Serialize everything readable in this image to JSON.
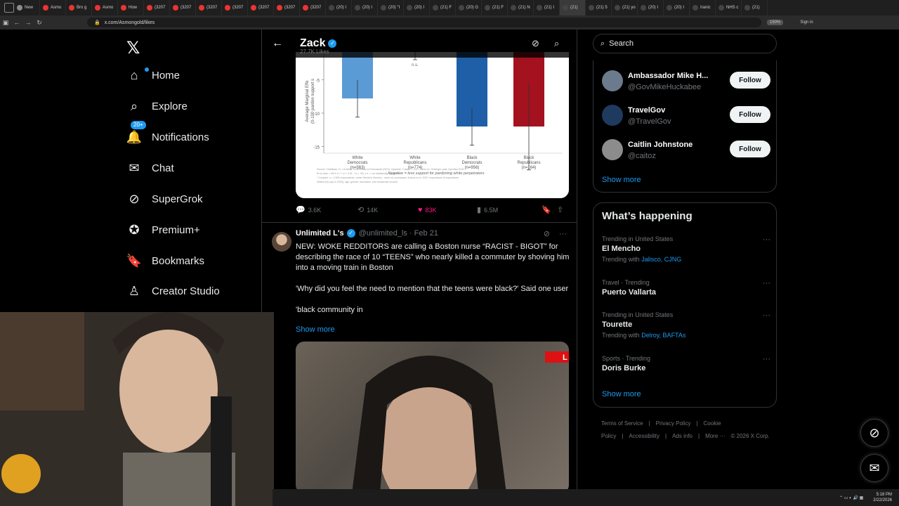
{
  "browser": {
    "tabs": [
      {
        "label": "New",
        "color": "#8c8c8c"
      },
      {
        "label": "Asmo",
        "color": "#e33"
      },
      {
        "label": "Bro g",
        "color": "#e33"
      },
      {
        "label": "Asmo",
        "color": "#e33"
      },
      {
        "label": "How",
        "color": "#e33"
      },
      {
        "label": "(3207",
        "color": "#e33"
      },
      {
        "label": "(3207",
        "color": "#e33"
      },
      {
        "label": "(3207",
        "color": "#e33"
      },
      {
        "label": "(3207",
        "color": "#e33"
      },
      {
        "label": "(3207",
        "color": "#e33"
      },
      {
        "label": "(3207",
        "color": "#e33"
      },
      {
        "label": "(3207",
        "color": "#e33"
      },
      {
        "label": "(20) I",
        "color": "#444"
      },
      {
        "label": "(20) I",
        "color": "#444"
      },
      {
        "label": "(20) \"I",
        "color": "#444"
      },
      {
        "label": "(20) I",
        "color": "#444"
      },
      {
        "label": "(21) F",
        "color": "#444"
      },
      {
        "label": "(20) G",
        "color": "#444"
      },
      {
        "label": "(21) F",
        "color": "#444"
      },
      {
        "label": "(21) N",
        "color": "#444"
      },
      {
        "label": "(21) I",
        "color": "#444"
      },
      {
        "label": "(21)",
        "color": "#444",
        "active": true
      },
      {
        "label": "(21) 5",
        "color": "#444"
      },
      {
        "label": "(21) yo",
        "color": "#444"
      },
      {
        "label": "(20) I",
        "color": "#444"
      },
      {
        "label": "(20) I",
        "color": "#444"
      },
      {
        "label": "Iranic",
        "color": "#444"
      },
      {
        "label": "NHS c",
        "color": "#444"
      },
      {
        "label": "(21)",
        "color": "#444"
      }
    ],
    "url": "x.com/Asmongold/likes",
    "zoom": "150%",
    "signin": "Sign in"
  },
  "nav": {
    "logo": "𝕏",
    "items": [
      {
        "label": "Home",
        "icon": "⌂"
      },
      {
        "label": "Explore",
        "icon": "⌕"
      },
      {
        "label": "Notifications",
        "icon": "🔔",
        "badge": "20+"
      },
      {
        "label": "Chat",
        "icon": "✉"
      },
      {
        "label": "SuperGrok",
        "icon": "⊘"
      },
      {
        "label": "Premium+",
        "icon": "✪"
      },
      {
        "label": "Bookmarks",
        "icon": "🔖"
      },
      {
        "label": "Creator Studio",
        "icon": "♙"
      }
    ]
  },
  "header": {
    "back": "←",
    "title": "Zack",
    "subtitle": "27.7K Likes"
  },
  "chart_data": {
    "type": "bar",
    "categories": [
      "White\nDemocrats\n(n=563)",
      "White\nRepublicans\n(n=774)",
      "Black\nDemocrats\n(n=956)",
      "Black\nRepublicans\n(n=164)"
    ],
    "values": [
      -7.8,
      -0.8,
      -12,
      -12
    ],
    "errors": [
      2.8,
      1.2,
      2.8,
      6.5
    ],
    "bar_colors": [
      "#5b9bd5",
      "#cccccc",
      "#1f5fa8",
      "#a3121e"
    ],
    "ylabel": "Average Marginal Effe",
    "ylabel2": "(0-100 pardon support s",
    "yticks": [
      -5,
      -10,
      -15
    ],
    "ylim": [
      -20,
      0
    ],
    "note": "Negative = less support for pardoning white perpetrators",
    "na_label": "n.s.",
    "source_lines": [
      "Source: Chistilsan, H., Lerdhau, Chommisau & Ehrouawsll (2021). Nparedz: Tulas d T u in t. Nrich on: Tinbinger paar, hiprvllka 2022.",
      "Error bars = 95% CI; ** p < 0.01, * p < .05; n.s. = not statistically significant.",
      "* Conjoint: n = 2,500 respondents, under Nevick's Dimulec - each ca. purchased. Antone et al. 2020. Importance of expenditure",
      "   related (for pay in 2020), age, gender, education, and household income."
    ]
  },
  "tweet1": {
    "replies": "3.6K",
    "reposts": "14K",
    "likes": "83K",
    "views": "6.5M"
  },
  "tweet2": {
    "name": "Unlimited L's",
    "handle": "@unlimited_ls · Feb 21",
    "text1": "NEW: WOKE REDDITORS are calling a Boston nurse “RACIST - BIGOT” for describing the race of 10 “TEENS” who nearly killed a commuter by shoving him into a moving train in Boston",
    "text2": "'Why did you feel the need to mention that the teens were black?' Said one user",
    "text3": "'black community in",
    "show_more": "Show more",
    "video_tag": "L"
  },
  "right": {
    "search_placeholder": "Search",
    "follows": [
      {
        "name": "Ambassador Mike H...",
        "handle": "@GovMikeHuckabee",
        "avatar_color": "#6b7a8c"
      },
      {
        "name": "TravelGov",
        "handle": "@TravelGov",
        "avatar_color": "#1f3a5f"
      },
      {
        "name": "Caitlin Johnstone",
        "handle": "@caitoz",
        "avatar_color": "#8c8c8c"
      }
    ],
    "follow_label": "Follow",
    "show_more": "Show more",
    "happening_title": "What’s happening",
    "trends": [
      {
        "context": "Trending in United States",
        "title": "El Mencho",
        "with_label": "Trending with",
        "with": "Jalisco, CJNG"
      },
      {
        "context": "Travel · Trending",
        "title": "Puerto Vallarta",
        "with_label": "",
        "with": ""
      },
      {
        "context": "Trending in United States",
        "title": "Tourette",
        "with_label": "Trending with",
        "with": "Delroy, BAFTAs"
      },
      {
        "context": "Sports · Trending",
        "title": "Doris Burke",
        "with_label": "",
        "with": ""
      }
    ],
    "show_more2": "Show more",
    "footer": [
      "Terms of Service",
      "|",
      "Privacy Policy",
      "|",
      "Cookie Policy",
      "|",
      "Accessibility",
      "|",
      "Ads info",
      "|",
      "More ···",
      "© 2026 X Corp."
    ]
  },
  "taskbar": {
    "time": "5:18 PM",
    "date": "2/22/2026"
  }
}
